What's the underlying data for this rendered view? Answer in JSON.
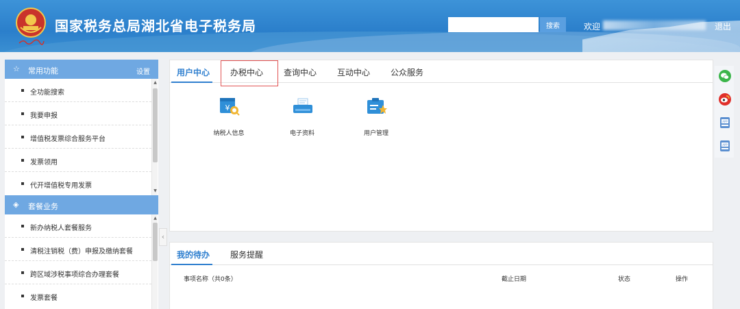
{
  "header": {
    "site_title": "国家税务总局湖北省电子税务局",
    "search_placeholder": "",
    "search_button": "搜索",
    "welcome": "欢迎",
    "logout": "退出",
    "brand_color": "#2b7fcb"
  },
  "sidebar": {
    "common": {
      "title": "常用功能",
      "settings_label": "设置",
      "icon": "star-icon",
      "items": [
        {
          "label": "全功能搜索"
        },
        {
          "label": "我要申报"
        },
        {
          "label": "增值税发票综合服务平台"
        },
        {
          "label": "发票领用"
        },
        {
          "label": "代开增值税专用发票"
        }
      ]
    },
    "package": {
      "title": "套餐业务",
      "icon": "layers-icon",
      "items": [
        {
          "label": "新办纳税人套餐服务"
        },
        {
          "label": "清税注销税（费）申报及缴纳套餐"
        },
        {
          "label": "跨区域涉税事项综合办理套餐"
        },
        {
          "label": "发票套餐"
        }
      ]
    }
  },
  "main": {
    "tabs": [
      {
        "label": "用户中心",
        "active": true
      },
      {
        "label": "办税中心",
        "active": false
      },
      {
        "label": "查询中心",
        "active": false
      },
      {
        "label": "互动中心",
        "active": false
      },
      {
        "label": "公众服务",
        "active": false
      }
    ],
    "apps": [
      {
        "label": "纳税人信息",
        "icon": "taxpayer-info-icon"
      },
      {
        "label": "电子资料",
        "icon": "electronic-document-icon"
      },
      {
        "label": "用户管理",
        "icon": "user-management-icon"
      }
    ]
  },
  "todo": {
    "tabs": [
      {
        "label": "我的待办",
        "active": true
      },
      {
        "label": "服务提醒",
        "active": false
      }
    ],
    "columns": {
      "name": "事项名称（共0条）",
      "deadline": "截止日期",
      "status": "状态",
      "action": "操作"
    }
  },
  "float_icons": [
    "wechat-icon",
    "weibo-icon",
    "app-icon",
    "app-icon"
  ]
}
